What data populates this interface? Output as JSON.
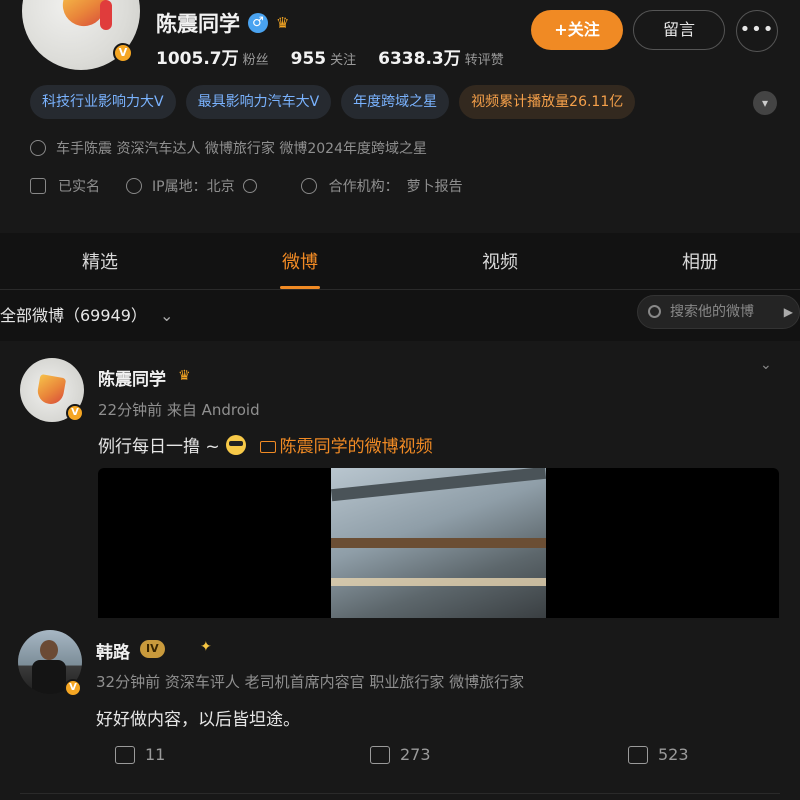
{
  "profile": {
    "name": "陈震同学",
    "gender_icon": "male-icon",
    "stats": [
      {
        "value": "1005.7万",
        "label": "粉丝"
      },
      {
        "value": "955",
        "label": "关注"
      },
      {
        "value": "6338.3万",
        "label": "转评赞"
      }
    ],
    "follow_label": "+关注",
    "message_label": "留言",
    "more_label": "•••",
    "tags": [
      {
        "text": "科技行业影响力大V",
        "style": "blue"
      },
      {
        "text": "最具影响力汽车大V",
        "style": "blue"
      },
      {
        "text": "年度跨域之星",
        "style": "blue"
      },
      {
        "text": "视频累计播放量26.11亿",
        "style": "orange"
      }
    ],
    "bio": "车手陈震 资深汽车达人 微博旅行家 微博2024年度跨域之星",
    "verified_label": "已实名",
    "ip_label": "IP属地：北京",
    "org_label": "合作机构：",
    "org_value": "萝卜报告"
  },
  "tabs": [
    {
      "label": "精选",
      "active": false
    },
    {
      "label": "微博",
      "active": true
    },
    {
      "label": "视频",
      "active": false
    },
    {
      "label": "相册",
      "active": false
    }
  ],
  "filter": {
    "label": "全部微博（69949）",
    "search_placeholder": "搜索他的微博"
  },
  "post": {
    "author": "陈震同学",
    "meta": "22分钟前 来自 Android",
    "text": "例行每日一撸 ~",
    "video_link": "陈震同学的微博视频"
  },
  "comment": {
    "author": "韩路",
    "level": "IV",
    "meta": "32分钟前 资深车评人 老司机首席内容官 职业旅行家 微博旅行家",
    "text": "好好做内容，以后皆坦途。"
  },
  "actions": {
    "share": "11",
    "comment": "273",
    "like": "523"
  },
  "colors": {
    "accent": "#f08a24",
    "tag_blue": "#7ab3ff",
    "background": "#121212"
  }
}
